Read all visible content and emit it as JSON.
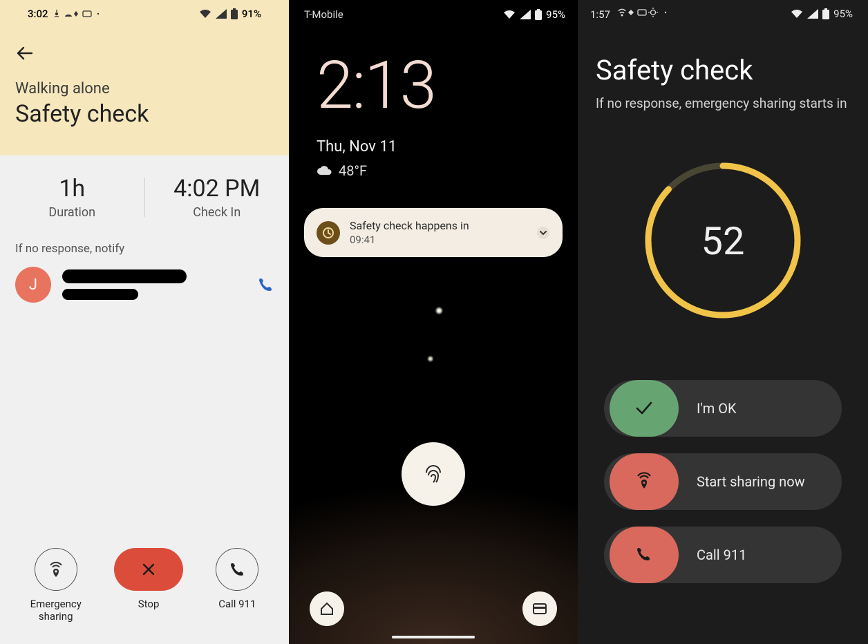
{
  "phone1": {
    "status": {
      "time": "3:02",
      "battery": "91%"
    },
    "header": {
      "subtitle": "Walking alone",
      "title": "Safety check"
    },
    "info": {
      "duration_value": "1h",
      "duration_label": "Duration",
      "checkin_value": "4:02 PM",
      "checkin_label": "Check In"
    },
    "notify_label": "If no response, notify",
    "contact": {
      "initial": "J"
    },
    "actions": {
      "emergency_sharing": "Emergency\nsharing",
      "stop": "Stop",
      "call_911": "Call 911"
    }
  },
  "phone2": {
    "carrier": "T-Mobile",
    "battery": "95%",
    "clock": "2:13",
    "date": "Thu, Nov 11",
    "temp": "48°F",
    "notification": {
      "title": "Safety check happens in",
      "time": "09:41"
    }
  },
  "phone3": {
    "status": {
      "time": "1:57",
      "battery": "95%"
    },
    "title": "Safety check",
    "subtitle": "If no response, emergency sharing starts in",
    "countdown": "52",
    "buttons": {
      "ok": "I'm OK",
      "share": "Start sharing now",
      "call911": "Call 911"
    },
    "ring_progress": 0.87
  }
}
